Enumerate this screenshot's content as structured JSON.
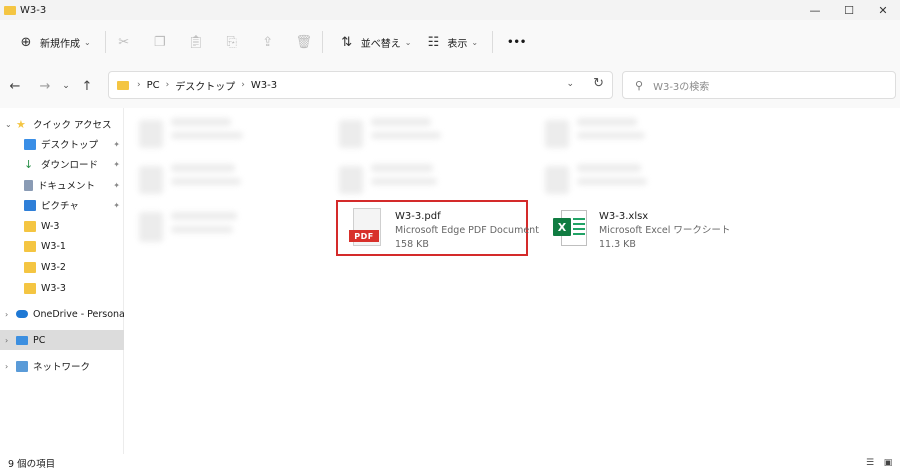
{
  "window": {
    "title": "W3-3",
    "minimize": "—",
    "maximize": "☐",
    "close": "✕"
  },
  "toolbar": {
    "new_label": "新規作成",
    "sort_label": "並べ替え",
    "view_label": "表示",
    "more": "•••"
  },
  "address": {
    "crumbs": [
      "PC",
      "デスクトップ",
      "W3-3"
    ],
    "sep": "›"
  },
  "search": {
    "placeholder": "W3-3の検索"
  },
  "sidebar": {
    "quick_access": "クイック アクセス",
    "items": [
      "デスクトップ",
      "ダウンロード",
      "ドキュメント",
      "ピクチャ",
      "W-3",
      "W3-1",
      "W3-2",
      "W3-3"
    ],
    "onedrive": "OneDrive - Personal",
    "pc": "PC",
    "network": "ネットワーク"
  },
  "files": [
    {
      "name": "W3-3.pdf",
      "type": "Microsoft Edge PDF Document",
      "size": "158 KB",
      "icon": "pdf-icon"
    },
    {
      "name": "W3-3.xlsx",
      "type": "Microsoft Excel ワークシート",
      "size": "11.3 KB",
      "icon": "excel-icon"
    }
  ],
  "icon_text": {
    "pdf": "PDF",
    "excel": "X"
  },
  "status": {
    "count": "9 個の項目"
  },
  "colors": {
    "highlight": "#d42a2a",
    "folder": "#f4c542",
    "pdf": "#d8302a",
    "excel": "#107c41"
  }
}
